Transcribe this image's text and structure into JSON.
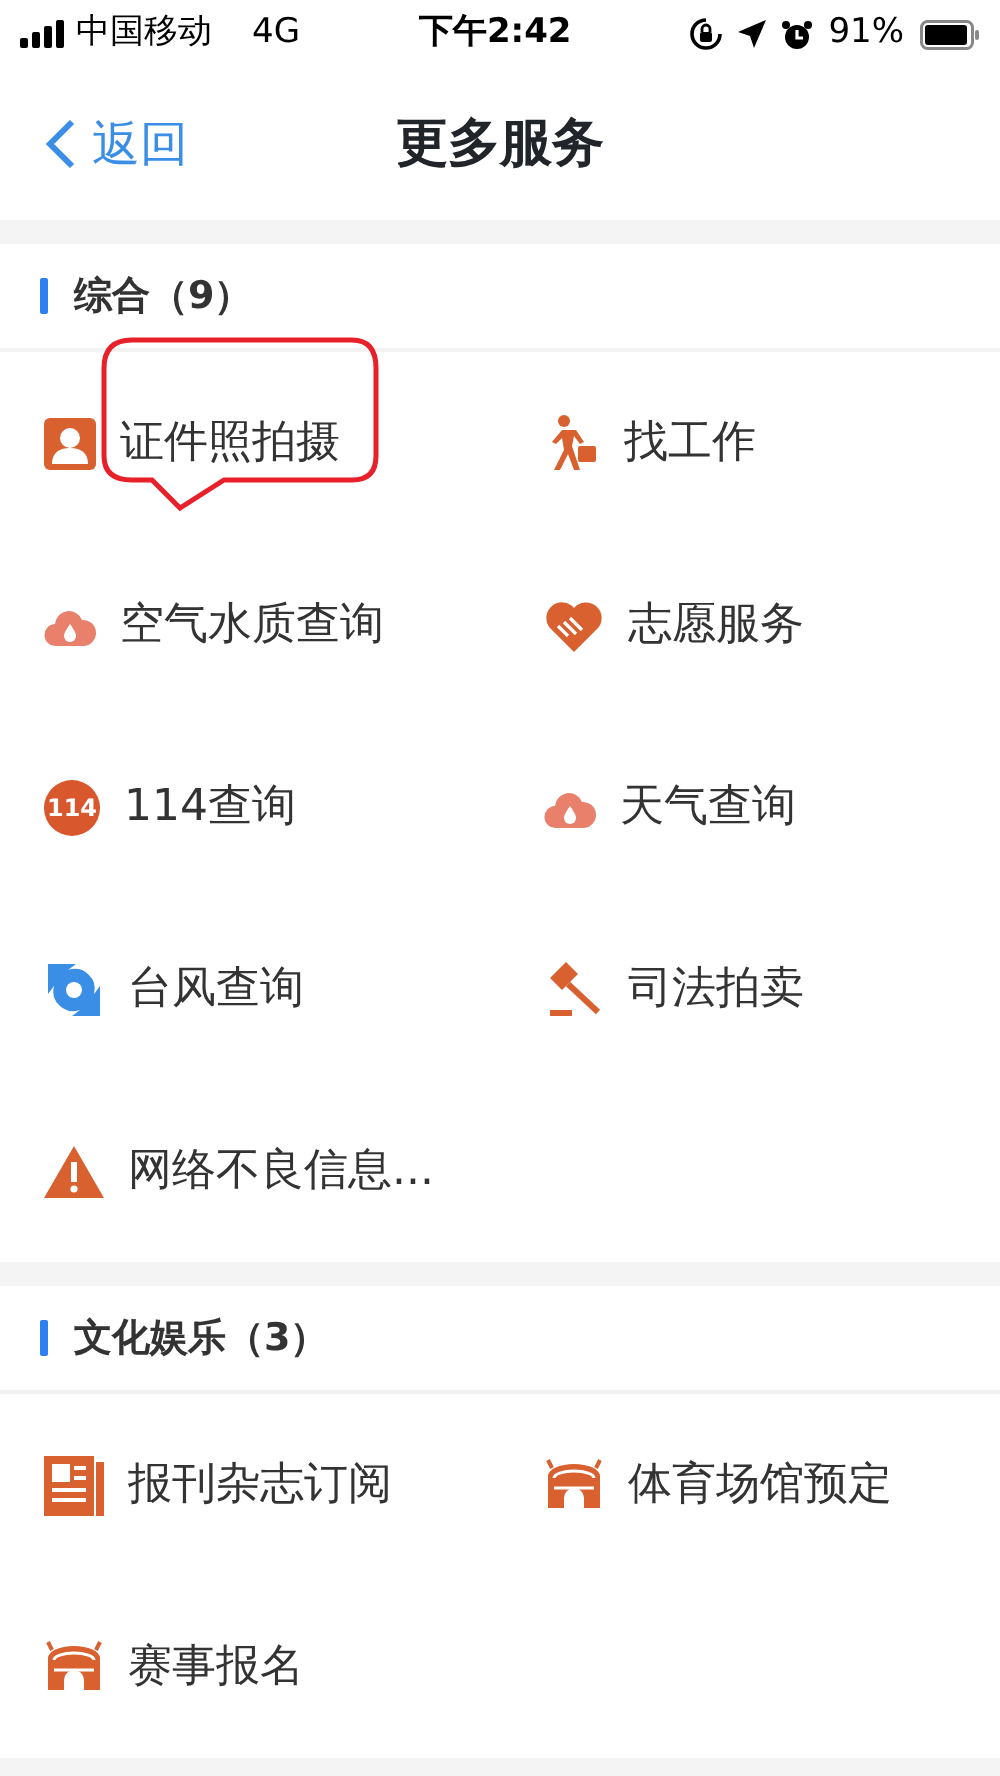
{
  "status_bar": {
    "carrier": "中国移动",
    "network": "4G",
    "time": "下午2:42",
    "battery": "91%"
  },
  "nav": {
    "back": "返回",
    "title": "更多服务"
  },
  "sections": [
    {
      "title": "综合（9）",
      "items": [
        {
          "label": "证件照拍摄",
          "highlighted": true
        },
        {
          "label": "找工作",
          "highlighted": false
        },
        {
          "label": "空气水质查询",
          "highlighted": false
        },
        {
          "label": "志愿服务",
          "highlighted": false
        },
        {
          "label": "114查询",
          "highlighted": false,
          "icon_text": "114"
        },
        {
          "label": "天气查询",
          "highlighted": false
        },
        {
          "label": "台风查询",
          "highlighted": false
        },
        {
          "label": "司法拍卖",
          "highlighted": false
        },
        {
          "label": "网络不良信息...",
          "highlighted": false
        }
      ]
    },
    {
      "title": "文化娱乐（3）",
      "items": [
        {
          "label": "报刊杂志订阅",
          "highlighted": false
        },
        {
          "label": "体育场馆预定",
          "highlighted": false
        },
        {
          "label": "赛事报名",
          "highlighted": false
        }
      ]
    }
  ]
}
